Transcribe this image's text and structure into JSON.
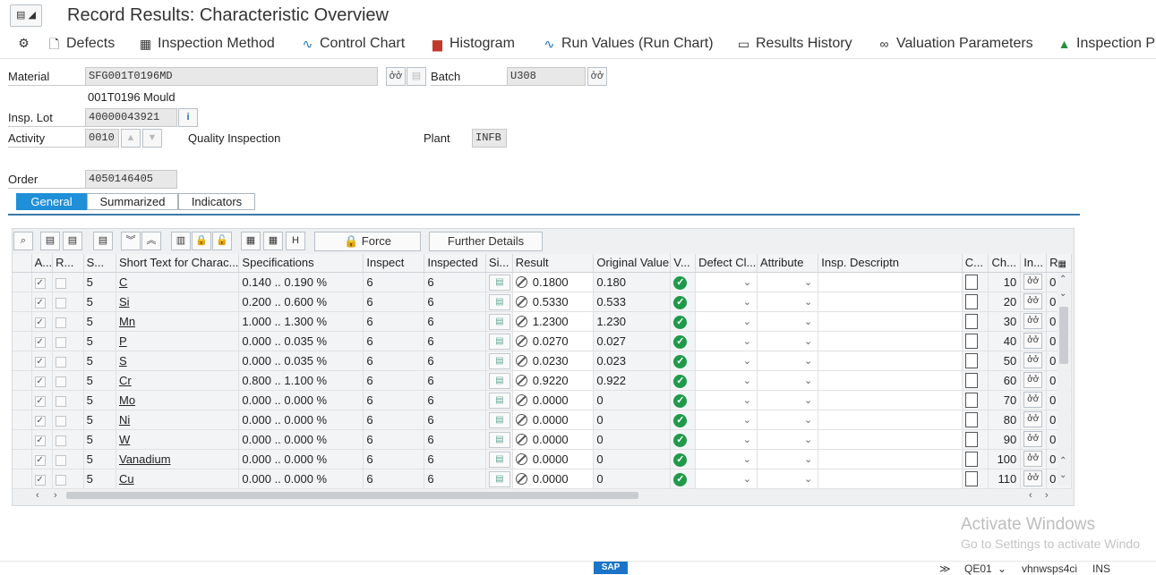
{
  "window": {
    "title": "Record Results: Characteristic Overview",
    "menu_icon": "menu-icon"
  },
  "toolbar": [
    {
      "label": "",
      "icon": "settings-icon"
    },
    {
      "label": "Defects",
      "icon": "document-icon"
    },
    {
      "label": "Inspection Method",
      "icon": "inspection-method-icon"
    },
    {
      "label": "Control Chart",
      "icon": "control-chart-icon"
    },
    {
      "label": "Histogram",
      "icon": "histogram-icon"
    },
    {
      "label": "Run Values (Run Chart)",
      "icon": "run-chart-icon"
    },
    {
      "label": "Results History",
      "icon": "history-icon"
    },
    {
      "label": "Valuation Parameters",
      "icon": "glasses-icon"
    },
    {
      "label": "Inspection P",
      "icon": "inspection-icon"
    }
  ],
  "header": {
    "material_label": "Material",
    "material_value": "SFG001T0196MD",
    "material_desc": "001T0196 Mould",
    "batch_label": "Batch",
    "batch_value": "U308",
    "insp_lot_label": "Insp. Lot",
    "insp_lot_value": "40000043921",
    "activity_label": "Activity",
    "activity_value": "0010",
    "activity_desc": "Quality Inspection",
    "plant_label": "Plant",
    "plant_value": "INFB",
    "order_label": "Order",
    "order_value": "4050146405"
  },
  "tabs": [
    {
      "label": "General",
      "active": true
    },
    {
      "label": "Summarized",
      "active": false
    },
    {
      "label": "Indicators",
      "active": false
    }
  ],
  "grid_toolbar": {
    "force_label": "Force",
    "further_details_label": "Further Details"
  },
  "columns": {
    "a": "A...",
    "r": "R...",
    "s": "S...",
    "short_text": "Short Text for Charac...",
    "specs": "Specifications",
    "inspect": "Inspect",
    "inspected": "Inspected",
    "si": "Si...",
    "result": "Result",
    "original": "Original Value",
    "v": "V...",
    "defect": "Defect Cl...",
    "attribute": "Attribute",
    "desc": "Insp. Descriptn",
    "c": "C...",
    "ch": "Ch...",
    "in": "In...",
    "r2": "R"
  },
  "rows": [
    {
      "s": "5",
      "text": "C",
      "spec": "0.140 .. 0.190 %",
      "inspect": "6",
      "inspected": "6",
      "result": "0.1800",
      "original": "0.180",
      "ch": "10",
      "r": "0"
    },
    {
      "s": "5",
      "text": "Si",
      "spec": "0.200 .. 0.600 %",
      "inspect": "6",
      "inspected": "6",
      "result": "0.5330",
      "original": "0.533",
      "ch": "20",
      "r": "0"
    },
    {
      "s": "5",
      "text": "Mn",
      "spec": "1.000 .. 1.300 %",
      "inspect": "6",
      "inspected": "6",
      "result": "1.2300",
      "original": "1.230",
      "ch": "30",
      "r": "0"
    },
    {
      "s": "5",
      "text": "P",
      "spec": "0.000 .. 0.035 %",
      "inspect": "6",
      "inspected": "6",
      "result": "0.0270",
      "original": "0.027",
      "ch": "40",
      "r": "0"
    },
    {
      "s": "5",
      "text": "S",
      "spec": "0.000 .. 0.035 %",
      "inspect": "6",
      "inspected": "6",
      "result": "0.0230",
      "original": "0.023",
      "ch": "50",
      "r": "0"
    },
    {
      "s": "5",
      "text": "Cr",
      "spec": "0.800 .. 1.100 %",
      "inspect": "6",
      "inspected": "6",
      "result": "0.9220",
      "original": "0.922",
      "ch": "60",
      "r": "0"
    },
    {
      "s": "5",
      "text": "Mo",
      "spec": "0.000 .. 0.000 %",
      "inspect": "6",
      "inspected": "6",
      "result": "0.0000",
      "original": "0",
      "ch": "70",
      "r": "0"
    },
    {
      "s": "5",
      "text": "Ni",
      "spec": "0.000 .. 0.000 %",
      "inspect": "6",
      "inspected": "6",
      "result": "0.0000",
      "original": "0",
      "ch": "80",
      "r": "0"
    },
    {
      "s": "5",
      "text": "W",
      "spec": "0.000 .. 0.000 %",
      "inspect": "6",
      "inspected": "6",
      "result": "0.0000",
      "original": "0",
      "ch": "90",
      "r": "0"
    },
    {
      "s": "5",
      "text": "Vanadium",
      "spec": "0.000 .. 0.000 %",
      "inspect": "6",
      "inspected": "6",
      "result": "0.0000",
      "original": "0",
      "ch": "100",
      "r": "0"
    },
    {
      "s": "5",
      "text": "Cu",
      "spec": "0.000 .. 0.000 %",
      "inspect": "6",
      "inspected": "6",
      "result": "0.0000",
      "original": "0",
      "ch": "110",
      "r": "0"
    }
  ],
  "watermark": {
    "line1": "Activate Windows",
    "line2": "Go to Settings to activate Windo"
  },
  "status": {
    "logo": "SAP",
    "system": "QE01",
    "server": "vhnwsps4ci",
    "mode": "INS"
  }
}
